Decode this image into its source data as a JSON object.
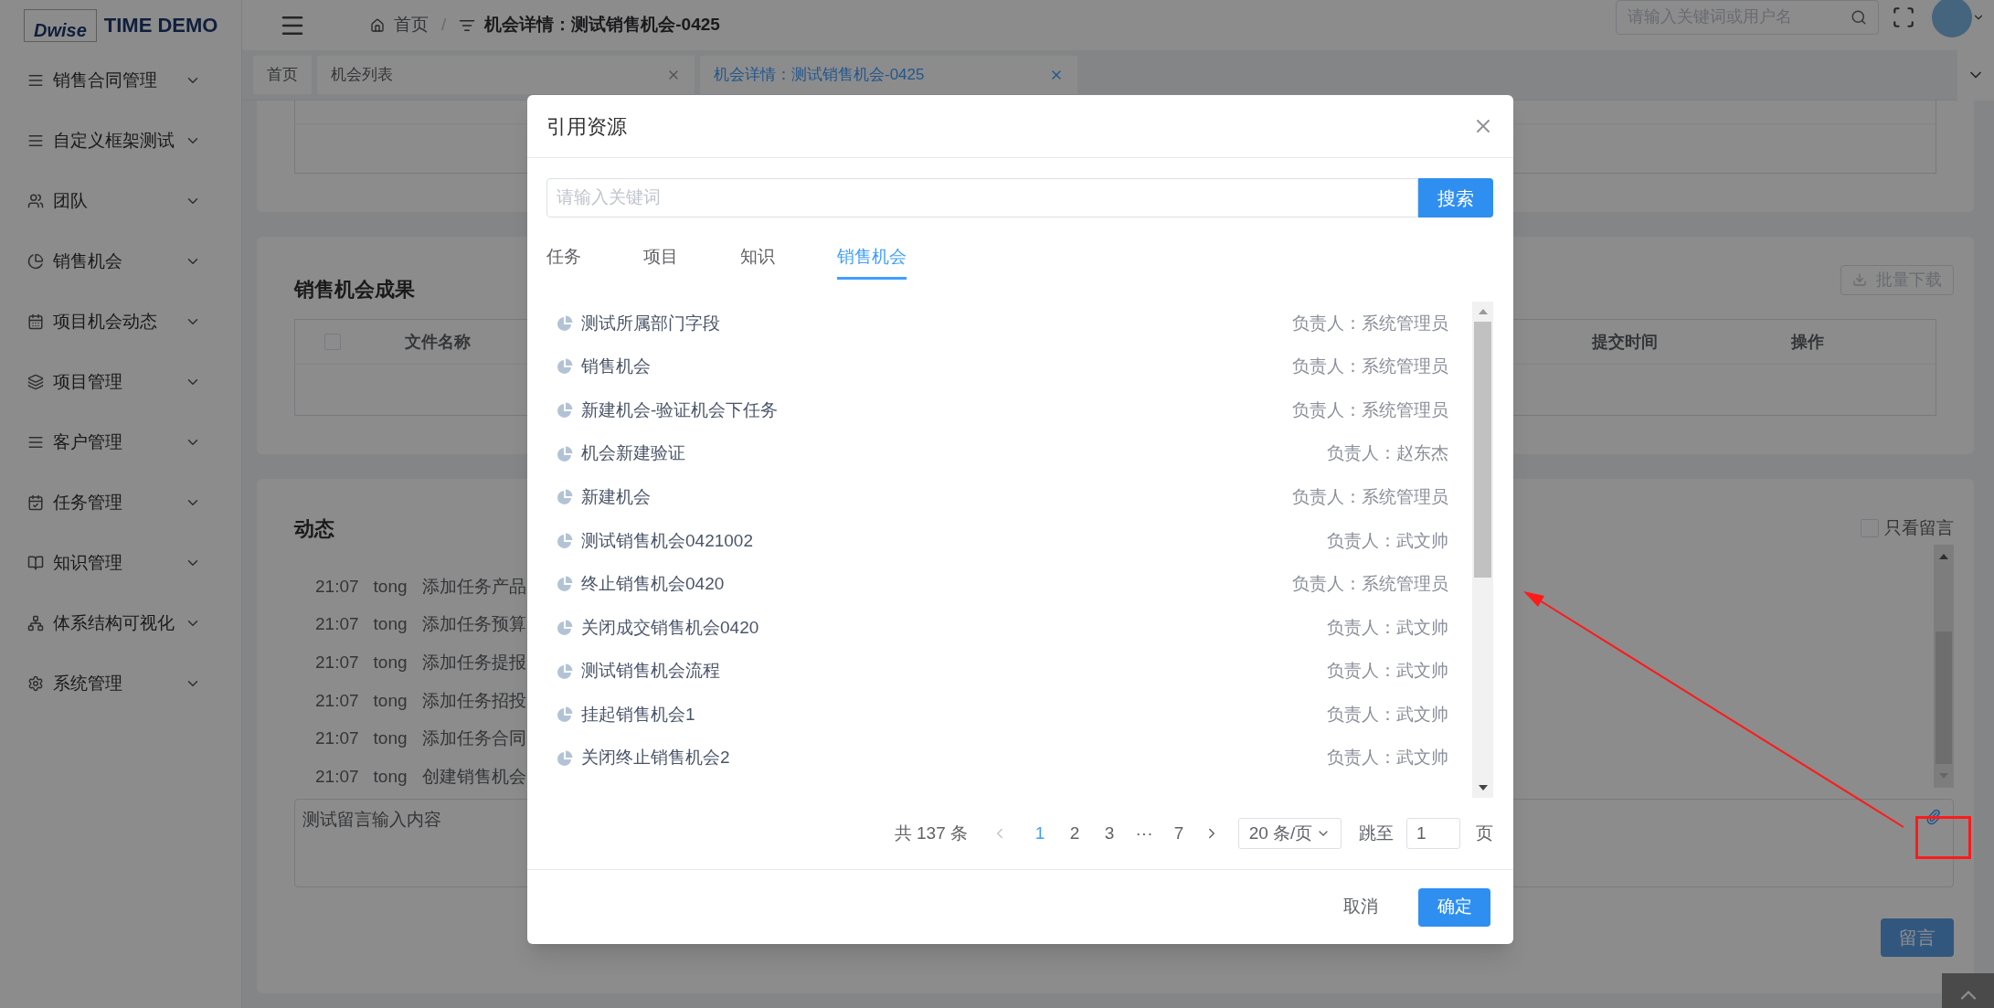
{
  "app": {
    "logo_mark": "Dwise",
    "logo_text": "TIME DEMO"
  },
  "sidebar": {
    "items": [
      {
        "label": "销售合同管理"
      },
      {
        "label": "自定义框架测试"
      },
      {
        "label": "团队"
      },
      {
        "label": "销售机会"
      },
      {
        "label": "项目机会动态"
      },
      {
        "label": "项目管理"
      },
      {
        "label": "客户管理"
      },
      {
        "label": "任务管理"
      },
      {
        "label": "知识管理"
      },
      {
        "label": "体系结构可视化"
      },
      {
        "label": "系统管理"
      }
    ]
  },
  "header": {
    "breadcrumb": [
      "首页",
      "机会详情：测试销售机会-0425"
    ],
    "separator": "/",
    "search": {
      "placeholder": "请输入关键词或用户名"
    }
  },
  "tabs": [
    {
      "label": "首页",
      "selected": false,
      "closable": false
    },
    {
      "label": "机会列表",
      "selected": false,
      "closable": true
    },
    {
      "label": "机会详情：测试销售机会-0425",
      "selected": true,
      "closable": true
    }
  ],
  "results": {
    "title": "销售机会成果",
    "download_button": "批量下载",
    "select_all": {
      "checked": false
    },
    "columns": [
      "文件名称",
      "提交时间",
      "操作"
    ]
  },
  "activity": {
    "title": "动态",
    "only_messages": {
      "label": "只看留言",
      "checked": false
    },
    "entries": [
      {
        "time": "21:07",
        "user": "tong",
        "text": "添加任务产品"
      },
      {
        "time": "21:07",
        "user": "tong",
        "text": "添加任务预算"
      },
      {
        "time": "21:07",
        "user": "tong",
        "text": "添加任务提报"
      },
      {
        "time": "21:07",
        "user": "tong",
        "text": "添加任务招投"
      },
      {
        "time": "21:07",
        "user": "tong",
        "text": "添加任务合同"
      },
      {
        "time": "21:07",
        "user": "tong",
        "text": "创建销售机会"
      }
    ],
    "comment": {
      "value": "测试留言输入内容"
    },
    "submit": "留言"
  },
  "dialog": {
    "title": "引用资源",
    "search": {
      "placeholder": "请输入关键词",
      "button": "搜索"
    },
    "tabs": [
      {
        "label": "任务",
        "selected": false
      },
      {
        "label": "项目",
        "selected": false
      },
      {
        "label": "知识",
        "selected": false
      },
      {
        "label": "销售机会",
        "selected": true
      }
    ],
    "items": [
      {
        "name": "测试所属部门字段",
        "owner": "负责人：系统管理员"
      },
      {
        "name": "销售机会",
        "owner": "负责人：系统管理员"
      },
      {
        "name": "新建机会-验证机会下任务",
        "owner": "负责人：系统管理员"
      },
      {
        "name": "机会新建验证",
        "owner": "负责人：赵东杰"
      },
      {
        "name": "新建机会",
        "owner": "负责人：系统管理员"
      },
      {
        "name": "测试销售机会0421002",
        "owner": "负责人：武文帅"
      },
      {
        "name": "终止销售机会0420",
        "owner": "负责人：系统管理员"
      },
      {
        "name": "关闭成交销售机会0420",
        "owner": "负责人：武文帅"
      },
      {
        "name": "测试销售机会流程",
        "owner": "负责人：武文帅"
      },
      {
        "name": "挂起销售机会1",
        "owner": "负责人：武文帅"
      },
      {
        "name": "关闭终止销售机会2",
        "owner": "负责人：武文帅"
      }
    ],
    "pagination": {
      "total": "共 137 条",
      "pages": [
        {
          "label": "1",
          "selected": true
        },
        {
          "label": "2",
          "selected": false
        },
        {
          "label": "3",
          "selected": false
        },
        {
          "label": "···",
          "selected": false
        },
        {
          "label": "7",
          "selected": false
        }
      ],
      "page_size": "20 条/页",
      "jump_label": "跳至",
      "jump_value": "1",
      "page_suffix": "页"
    },
    "buttons": {
      "cancel": "取消",
      "confirm": "确定"
    }
  }
}
